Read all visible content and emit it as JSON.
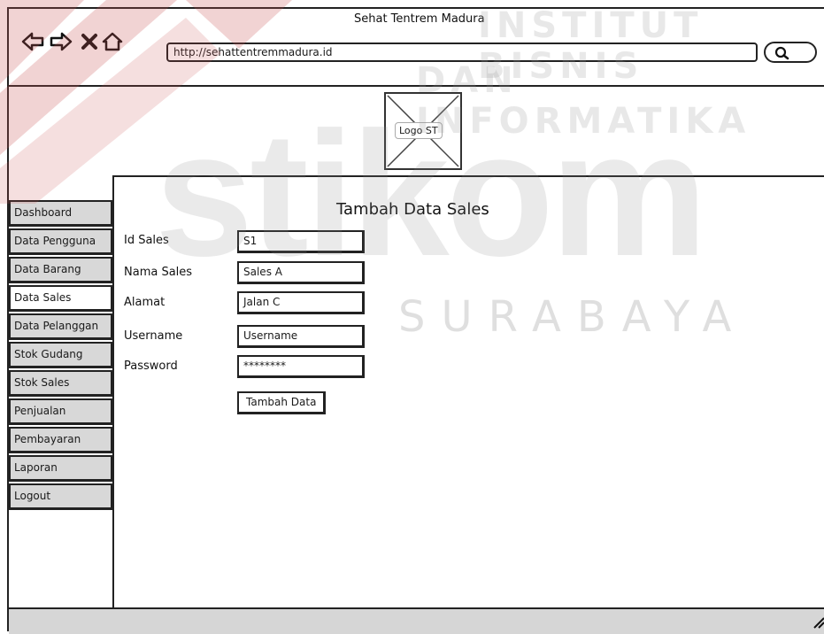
{
  "window": {
    "title": "Sehat Tentrem Madura",
    "url": "http://sehattentremmadura.id"
  },
  "logo": {
    "label": "Logo ST"
  },
  "page": {
    "title": "Tambah Data Sales"
  },
  "sidebar": {
    "items": [
      {
        "label": "Dashboard",
        "active": false
      },
      {
        "label": "Data Pengguna",
        "active": false
      },
      {
        "label": "Data Barang",
        "active": false
      },
      {
        "label": "Data Sales",
        "active": true
      },
      {
        "label": "Data Pelanggan",
        "active": false
      },
      {
        "label": "Stok Gudang",
        "active": false
      },
      {
        "label": "Stok Sales",
        "active": false
      },
      {
        "label": "Penjualan",
        "active": false
      },
      {
        "label": "Pembayaran",
        "active": false
      },
      {
        "label": "Laporan",
        "active": false
      },
      {
        "label": "Logout",
        "active": false
      }
    ]
  },
  "form": {
    "fields": [
      {
        "label": "Id Sales",
        "value": "S1"
      },
      {
        "label": "Nama Sales",
        "value": "Sales A"
      },
      {
        "label": "Alamat",
        "value": "Jalan C"
      },
      {
        "label": "Username",
        "value": "Username"
      },
      {
        "label": "Password",
        "value": "********"
      }
    ],
    "submit_label": "Tambah Data"
  },
  "watermark": {
    "line1": "INSTITUT BISNIS",
    "line2": "DAN INFORMATIKA",
    "brand": "stikom",
    "city": "SURABAYA"
  },
  "icons": {
    "back": "arrow-left-icon",
    "forward": "arrow-right-icon",
    "stop": "close-icon",
    "home": "home-icon",
    "search": "search-icon"
  }
}
